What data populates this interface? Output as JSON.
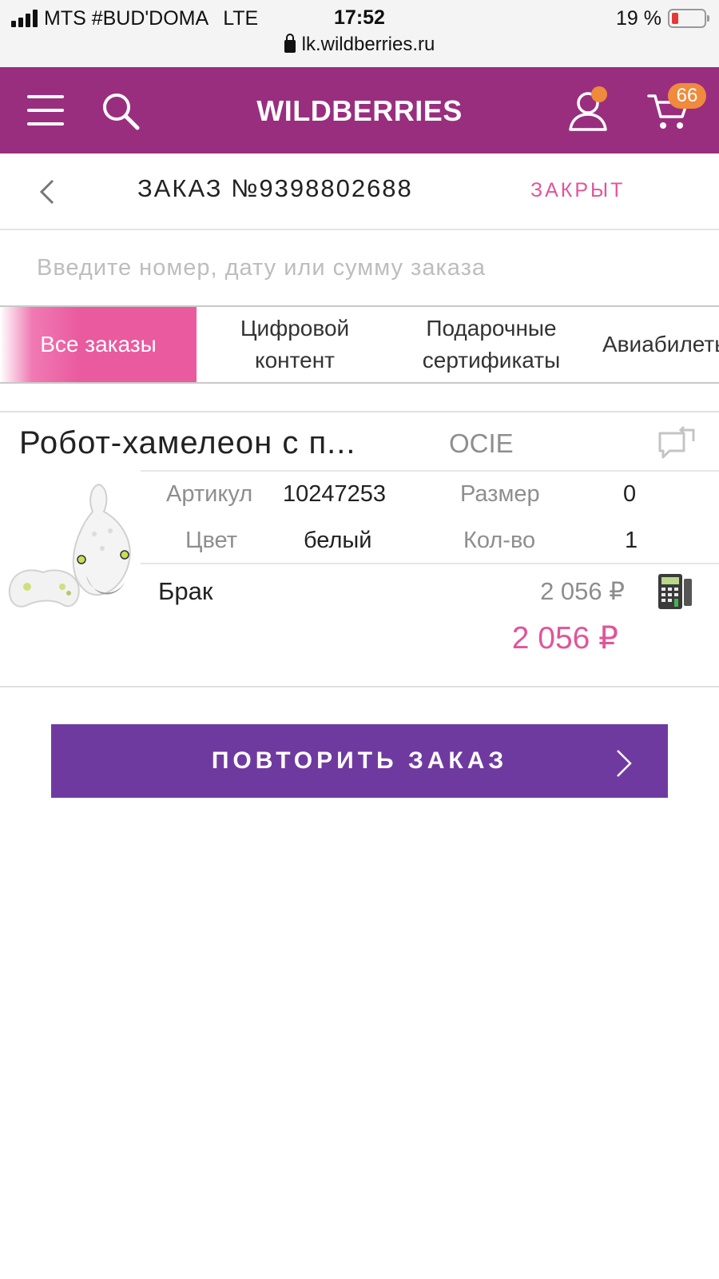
{
  "status_bar": {
    "carrier": "MTS #BUD'DOMA",
    "network": "LTE",
    "time": "17:52",
    "battery_text": "19 %",
    "battery_level": 0.19,
    "url": "lk.wildberries.ru"
  },
  "header": {
    "logo": "WILDBERRIES",
    "cart_count": "66",
    "brand_color": "#992e7f",
    "badge_color": "#f08a3c"
  },
  "order": {
    "title": "ЗАКАЗ №9398802688",
    "status": "ЗАКРЫТ"
  },
  "search": {
    "placeholder": "Введите номер, дату или сумму заказа"
  },
  "tabs": [
    {
      "label": "Все заказы",
      "active": true
    },
    {
      "label": "Цифровой\nконтент",
      "active": false
    },
    {
      "label": "Подарочные\nсертификаты",
      "active": false
    },
    {
      "label": "Авиабилеты",
      "active": false
    }
  ],
  "item": {
    "name": "Робот-хамелеон с п...",
    "brand": "OCIE",
    "article_label": "Артикул",
    "article_value": "10247253",
    "size_label": "Размер",
    "size_value": "0",
    "color_label": "Цвет",
    "color_value": "белый",
    "qty_label": "Кол-во",
    "qty_value": "1",
    "reason": "Брак",
    "price": "2 056 ₽",
    "total": "2 056 ₽"
  },
  "actions": {
    "repeat_label": "ПОВТОРИТЬ ЗАКАЗ"
  },
  "colors": {
    "accent_pink": "#e0559a",
    "button_purple": "#6f3aa0"
  }
}
